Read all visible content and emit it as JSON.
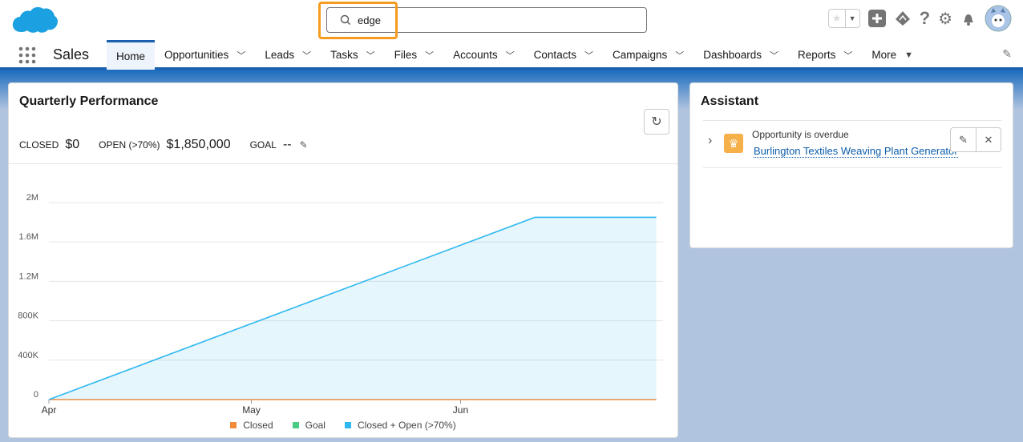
{
  "header": {
    "search_value": "edge",
    "app_name": "Sales"
  },
  "nav": {
    "tabs": [
      {
        "label": "Home",
        "active": true,
        "dropdown": false
      },
      {
        "label": "Opportunities",
        "dropdown": true
      },
      {
        "label": "Leads",
        "dropdown": true
      },
      {
        "label": "Tasks",
        "dropdown": true
      },
      {
        "label": "Files",
        "dropdown": true
      },
      {
        "label": "Accounts",
        "dropdown": true
      },
      {
        "label": "Contacts",
        "dropdown": true
      },
      {
        "label": "Campaigns",
        "dropdown": true
      },
      {
        "label": "Dashboards",
        "dropdown": true
      },
      {
        "label": "Reports",
        "dropdown": true
      },
      {
        "label": "More",
        "dropdown": true
      }
    ]
  },
  "performance": {
    "title": "Quarterly Performance",
    "closed_label": "CLOSED",
    "closed_value": "$0",
    "open_label": "OPEN (>70%)",
    "open_value": "$1,850,000",
    "goal_label": "GOAL",
    "goal_value": "--"
  },
  "chart_data": {
    "type": "area",
    "x_ticks": [
      "Apr",
      "May",
      "Jun"
    ],
    "y_ticks": [
      "0",
      "400K",
      "800K",
      "1.2M",
      "1.6M",
      "2M"
    ],
    "ylim": [
      0,
      2000000
    ],
    "xlim": [
      "Apr 1",
      "Jun 30"
    ],
    "grid": true,
    "legend_placement": "bottom",
    "series": [
      {
        "name": "Closed",
        "color": "#f38b3c",
        "points": [
          [
            "Apr 1",
            0
          ],
          [
            "Jun 30",
            0
          ]
        ]
      },
      {
        "name": "Goal",
        "color": "#4bca81",
        "points": []
      },
      {
        "name": "Closed + Open (>70%)",
        "color": "#2fb8ef",
        "points": [
          [
            "Apr 1",
            0
          ],
          [
            "Jun 12",
            1850000
          ],
          [
            "Jun 30",
            1850000
          ]
        ]
      }
    ]
  },
  "assistant": {
    "title": "Assistant",
    "item_text": "Opportunity is overdue",
    "item_link": "Burlington Textiles Weaving Plant Generator"
  }
}
